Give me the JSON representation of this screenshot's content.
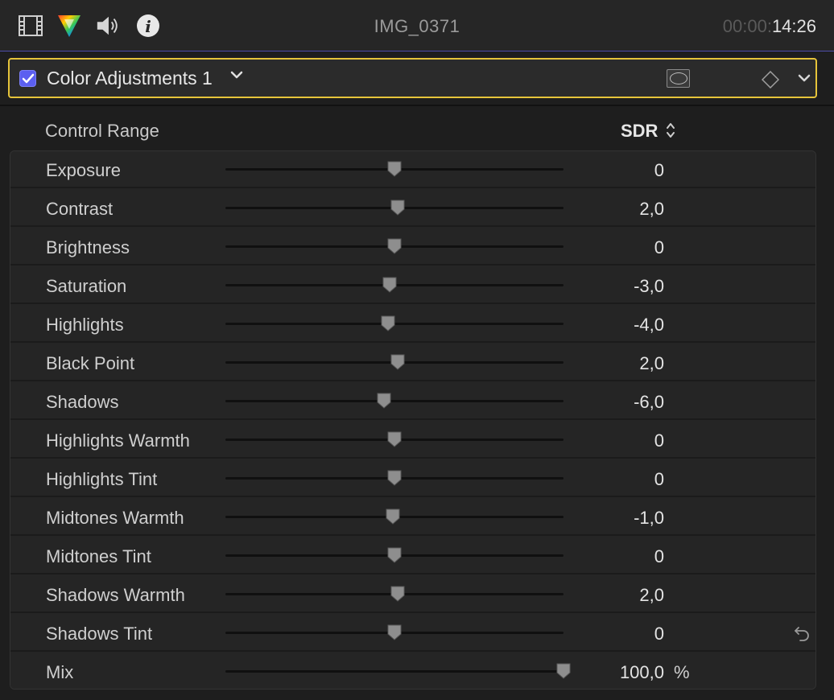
{
  "header": {
    "title": "IMG_0371",
    "timecode_dim": "00:00:",
    "timecode_bright": "14:26",
    "icons": [
      "film-icon",
      "color-prism-icon",
      "speaker-icon",
      "info-icon"
    ]
  },
  "effect": {
    "name": "Color Adjustments 1",
    "enabled": true,
    "accent_color": "#e6c43a",
    "checkbox_color": "#5b5ff0"
  },
  "control_range": {
    "label": "Control Range",
    "value": "SDR"
  },
  "parameters": [
    {
      "label": "Exposure",
      "value": "0",
      "slider": 0.5
    },
    {
      "label": "Contrast",
      "value": "2,0",
      "slider": 0.51
    },
    {
      "label": "Brightness",
      "value": "0",
      "slider": 0.5
    },
    {
      "label": "Saturation",
      "value": "-3,0",
      "slider": 0.485
    },
    {
      "label": "Highlights",
      "value": "-4,0",
      "slider": 0.48
    },
    {
      "label": "Black Point",
      "value": "2,0",
      "slider": 0.51
    },
    {
      "label": "Shadows",
      "value": "-6,0",
      "slider": 0.47
    },
    {
      "label": "Highlights Warmth",
      "value": "0",
      "slider": 0.5
    },
    {
      "label": "Highlights Tint",
      "value": "0",
      "slider": 0.5
    },
    {
      "label": "Midtones Warmth",
      "value": "-1,0",
      "slider": 0.495
    },
    {
      "label": "Midtones Tint",
      "value": "0",
      "slider": 0.5
    },
    {
      "label": "Shadows Warmth",
      "value": "2,0",
      "slider": 0.51
    },
    {
      "label": "Shadows Tint",
      "value": "0",
      "slider": 0.5
    },
    {
      "label": "Mix",
      "value": "100,0",
      "unit": "%",
      "slider": 1.0
    }
  ]
}
